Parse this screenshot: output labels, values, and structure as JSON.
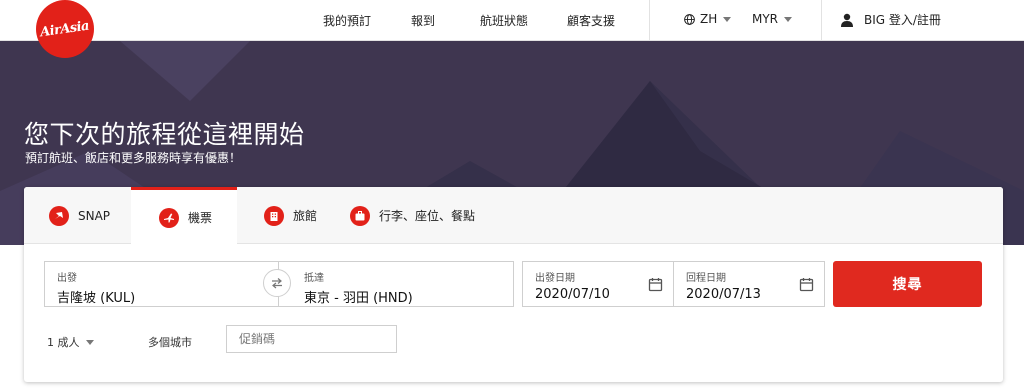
{
  "brand": {
    "logo_text": "AirAsia",
    "accent": "#e22119"
  },
  "nav": {
    "links": [
      "我的預訂",
      "報到",
      "航班狀態",
      "顧客支援"
    ],
    "language": "ZH",
    "currency": "MYR",
    "login_label": "BIG 登入/註冊"
  },
  "hero": {
    "title": "您下次的旅程從這裡開始",
    "subtitle": "預訂航班、飯店和更多服務時享有優惠！"
  },
  "tabs": [
    {
      "label": "SNAP",
      "icon": "snap-icon",
      "active": false
    },
    {
      "label": "機票",
      "icon": "plane-icon",
      "active": true
    },
    {
      "label": "旅館",
      "icon": "hotel-icon",
      "active": false
    },
    {
      "label": "行李、座位、餐點",
      "icon": "luggage-icon",
      "active": false
    }
  ],
  "form": {
    "origin": {
      "label": "出發",
      "value": "吉隆坡 (KUL)"
    },
    "destination": {
      "label": "抵達",
      "value": "東京 - 羽田 (HND)"
    },
    "depart_date": {
      "label": "出發日期",
      "value": "2020/07/10"
    },
    "return_date": {
      "label": "回程日期",
      "value": "2020/07/13"
    },
    "search_label": "搜尋",
    "passengers": "1 成人",
    "multi_city": "多個城市",
    "promo_placeholder": "促銷碼"
  }
}
